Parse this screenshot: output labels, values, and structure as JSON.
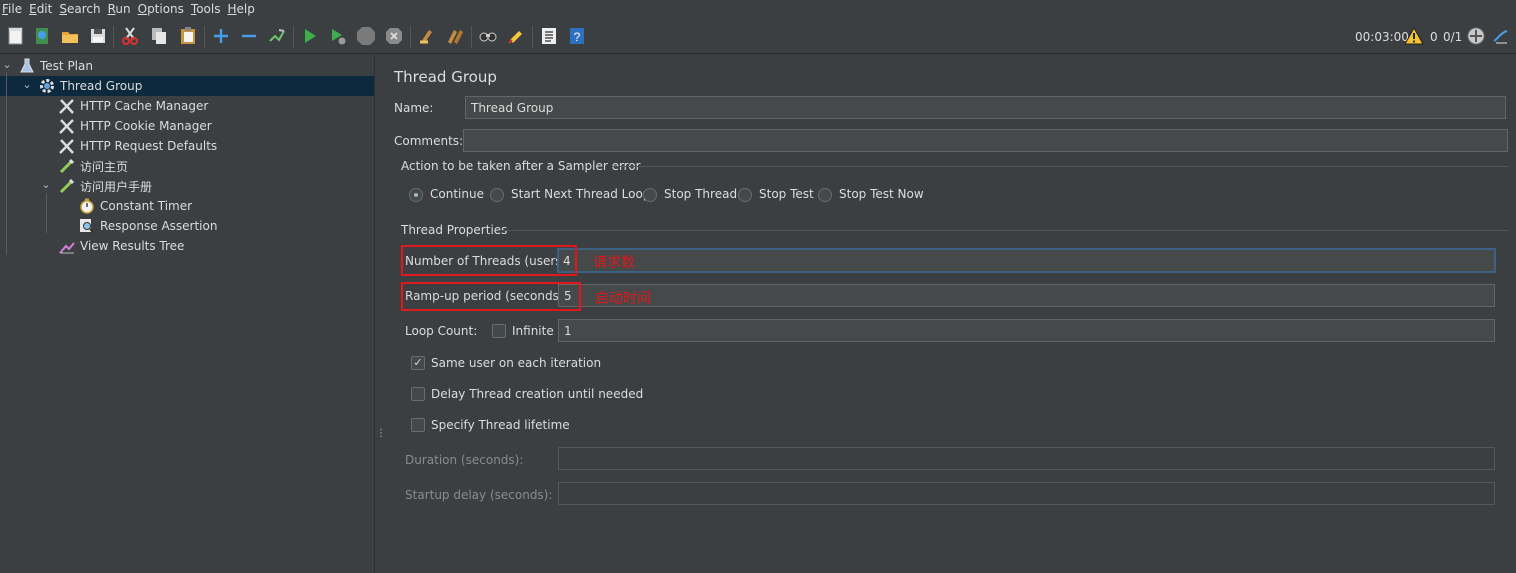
{
  "menubar": {
    "items": [
      {
        "first": "F",
        "rest": "ile"
      },
      {
        "first": "E",
        "rest": "dit"
      },
      {
        "first": "S",
        "rest": "earch"
      },
      {
        "first": "R",
        "rest": "un"
      },
      {
        "first": "O",
        "rest": "ptions"
      },
      {
        "first": "T",
        "rest": "ools"
      },
      {
        "first": "H",
        "rest": "elp"
      }
    ]
  },
  "toolbar": {
    "icons": [
      "new-icon",
      "templates-icon",
      "open-icon",
      "save-icon",
      "cut-icon",
      "copy-icon",
      "paste-icon",
      "expand-icon",
      "collapse-icon",
      "toggle-icon",
      "start-icon",
      "start-no-pauses-icon",
      "stop-icon",
      "shutdown-icon",
      "clear-icon",
      "clear-all-icon",
      "search-icon",
      "reset-search-icon",
      "function-helper-icon",
      "help-icon"
    ],
    "timer": "00:03:00",
    "warning_count": "0",
    "thread_count": "0/1",
    "accent_color": "#4a9ee8",
    "warning_color": "#f4c430"
  },
  "tree": {
    "nodes": [
      {
        "label": "Test Plan",
        "icon": "test-plan-icon"
      },
      {
        "label": "Thread Group",
        "icon": "gear-icon",
        "selected": true
      },
      {
        "label": "HTTP Cache Manager",
        "icon": "wrench-icon"
      },
      {
        "label": "HTTP Cookie Manager",
        "icon": "wrench-icon"
      },
      {
        "label": "HTTP Request Defaults",
        "icon": "wrench-icon"
      },
      {
        "label": "访问主页",
        "icon": "pipette-icon"
      },
      {
        "label": "访问用户手册",
        "icon": "pipette-icon"
      },
      {
        "label": "Constant Timer",
        "icon": "stopwatch-icon"
      },
      {
        "label": "Response Assertion",
        "icon": "magnifier-icon"
      },
      {
        "label": "View Results Tree",
        "icon": "chart-icon"
      }
    ]
  },
  "panel": {
    "title": "Thread Group",
    "name_label": "Name:",
    "name_value": "Thread Group",
    "comments_label": "Comments:",
    "comments_value": "",
    "error_section": "Action to be taken after a Sampler error",
    "error_options": [
      "Continue",
      "Start Next Thread Loop",
      "Stop Thread",
      "Stop Test",
      "Stop Test Now"
    ],
    "error_selected": "Continue",
    "props_section": "Thread Properties",
    "threads_label": "Number of Threads (users):",
    "threads_value": "4",
    "threads_annotation": "请求数",
    "rampup_label": "Ramp-up period (seconds):",
    "rampup_value": "5",
    "rampup_annotation": "启动时间",
    "loop_label": "Loop Count:",
    "infinite_label": "Infinite",
    "infinite_checked": false,
    "loop_value": "1",
    "same_user_label": "Same user on each iteration",
    "same_user_checked": true,
    "delay_label": "Delay Thread creation until needed",
    "delay_checked": false,
    "lifetime_label": "Specify Thread lifetime",
    "lifetime_checked": false,
    "duration_label": "Duration (seconds):",
    "duration_value": "",
    "startup_label": "Startup delay (seconds):",
    "startup_value": "",
    "highlight_color": "#e0181c"
  }
}
